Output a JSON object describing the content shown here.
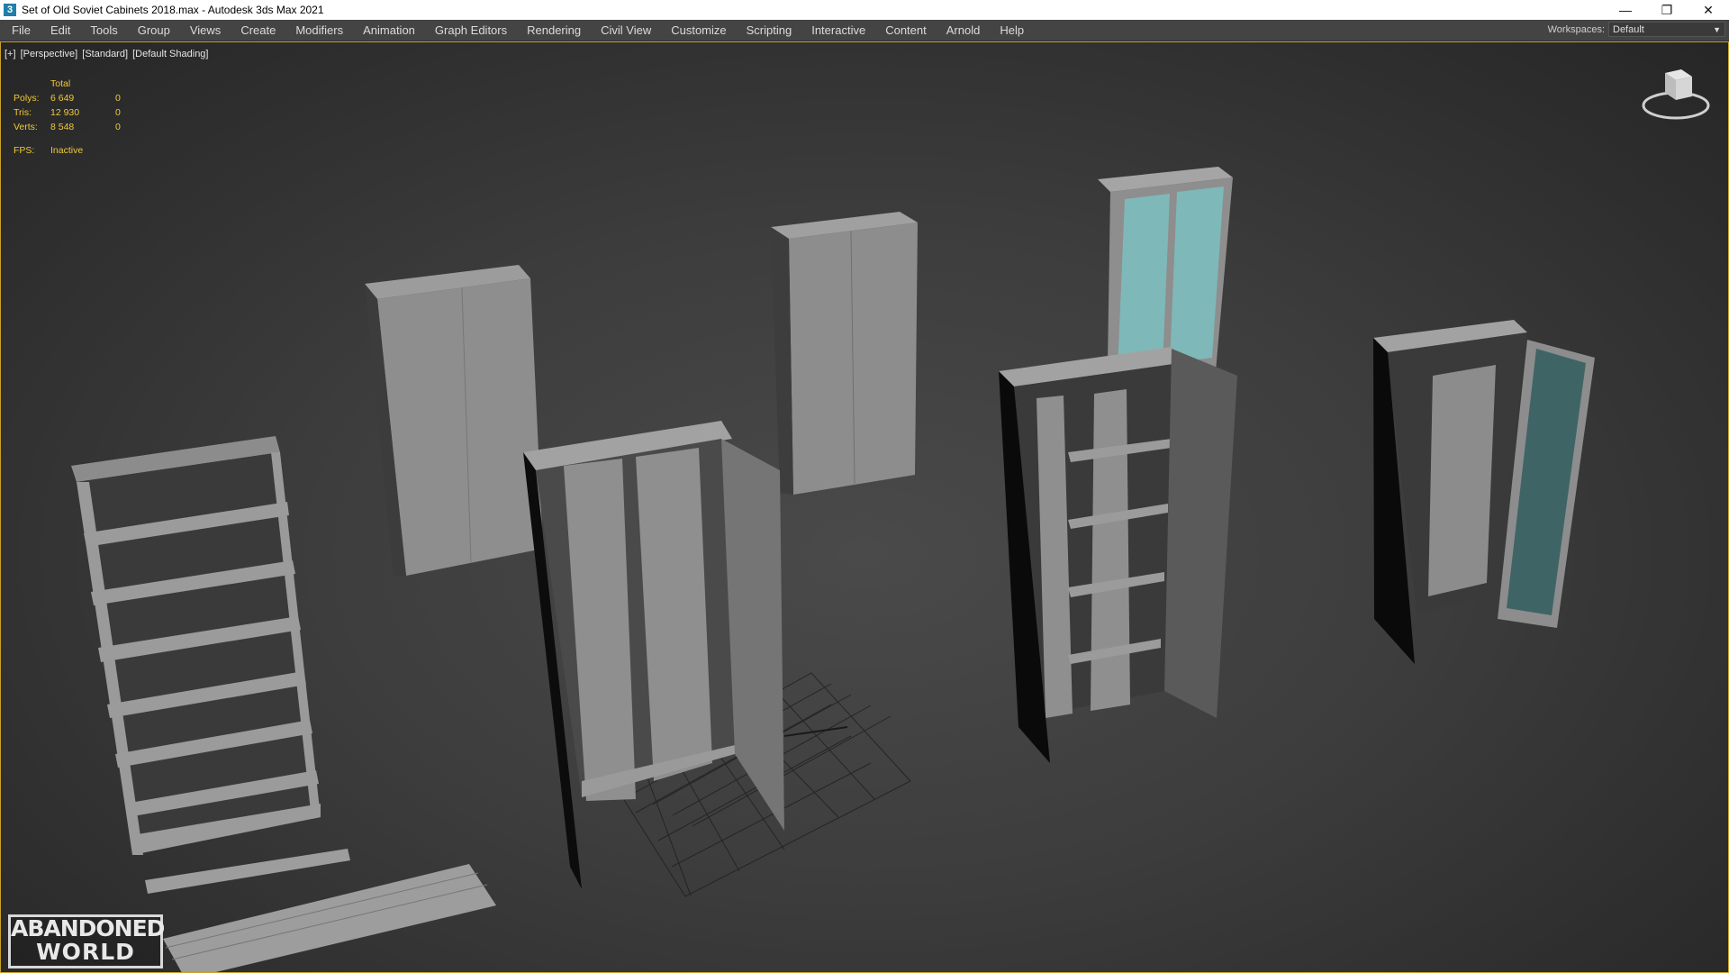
{
  "window": {
    "title": "Set of Old Soviet Cabinets 2018.max - Autodesk 3ds Max 2021",
    "app_icon": "3",
    "minimize": "—",
    "restore": "❐",
    "close": "✕"
  },
  "menu": [
    "File",
    "Edit",
    "Tools",
    "Group",
    "Views",
    "Create",
    "Modifiers",
    "Animation",
    "Graph Editors",
    "Rendering",
    "Civil View",
    "Customize",
    "Scripting",
    "Interactive",
    "Content",
    "Arnold",
    "Help"
  ],
  "workspaces": {
    "label": "Workspaces:",
    "value": "Default"
  },
  "viewport": {
    "labels": [
      "[+]",
      "[Perspective]",
      "[Standard]",
      "[Default Shading]"
    ],
    "stats": {
      "header": "Total",
      "rows": [
        {
          "key": "Polys:",
          "value": "6 649",
          "selected": "0"
        },
        {
          "key": "Tris:",
          "value": "12 930",
          "selected": "0"
        },
        {
          "key": "Verts:",
          "value": "8 548",
          "selected": "0"
        }
      ],
      "fps_key": "FPS:",
      "fps_value": "Inactive"
    }
  },
  "watermark": {
    "line1": "ABANDONED",
    "line2": "WORLD"
  },
  "colors": {
    "accent": "#c9a227",
    "stats_text": "#f0c93a",
    "glass": "#7fb8b8",
    "dark_glass": "#3f6466"
  }
}
